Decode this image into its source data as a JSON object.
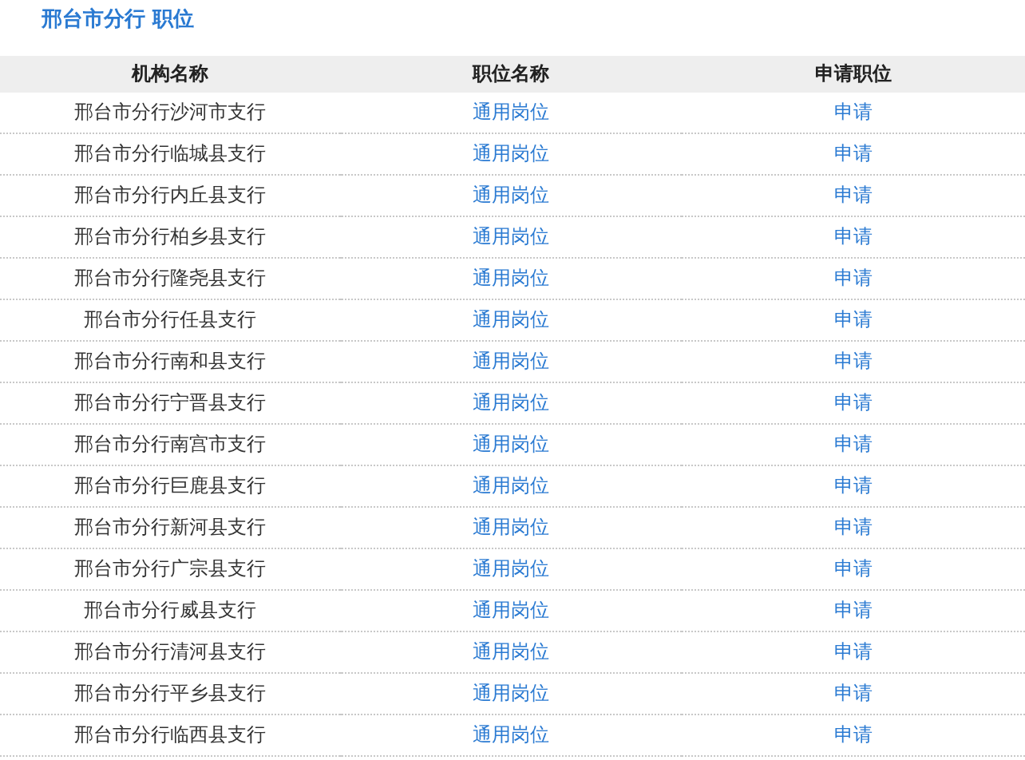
{
  "title": "邢台市分行 职位",
  "table": {
    "columns": [
      "机构名称",
      "职位名称",
      "申请职位"
    ],
    "rows": [
      {
        "org": "邢台市分行沙河市支行",
        "position": "通用岗位",
        "action": "申请"
      },
      {
        "org": "邢台市分行临城县支行",
        "position": "通用岗位",
        "action": "申请"
      },
      {
        "org": "邢台市分行内丘县支行",
        "position": "通用岗位",
        "action": "申请"
      },
      {
        "org": "邢台市分行柏乡县支行",
        "position": "通用岗位",
        "action": "申请"
      },
      {
        "org": "邢台市分行隆尧县支行",
        "position": "通用岗位",
        "action": "申请"
      },
      {
        "org": "邢台市分行任县支行",
        "position": "通用岗位",
        "action": "申请"
      },
      {
        "org": "邢台市分行南和县支行",
        "position": "通用岗位",
        "action": "申请"
      },
      {
        "org": "邢台市分行宁晋县支行",
        "position": "通用岗位",
        "action": "申请"
      },
      {
        "org": "邢台市分行南宫市支行",
        "position": "通用岗位",
        "action": "申请"
      },
      {
        "org": "邢台市分行巨鹿县支行",
        "position": "通用岗位",
        "action": "申请"
      },
      {
        "org": "邢台市分行新河县支行",
        "position": "通用岗位",
        "action": "申请"
      },
      {
        "org": "邢台市分行广宗县支行",
        "position": "通用岗位",
        "action": "申请"
      },
      {
        "org": "邢台市分行威县支行",
        "position": "通用岗位",
        "action": "申请"
      },
      {
        "org": "邢台市分行清河县支行",
        "position": "通用岗位",
        "action": "申请"
      },
      {
        "org": "邢台市分行平乡县支行",
        "position": "通用岗位",
        "action": "申请"
      },
      {
        "org": "邢台市分行临西县支行",
        "position": "通用岗位",
        "action": "申请"
      }
    ]
  }
}
